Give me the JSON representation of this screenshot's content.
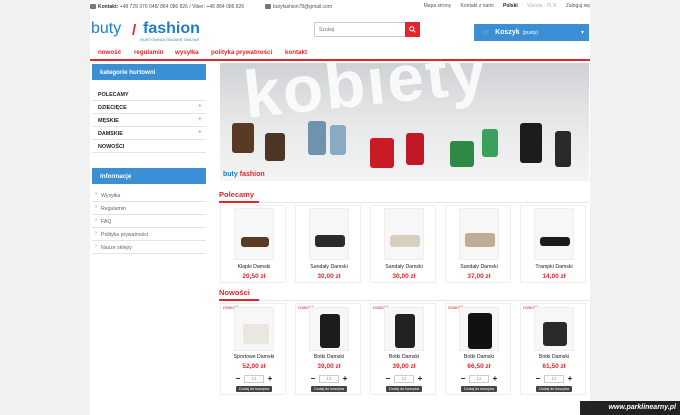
{
  "topbar": {
    "contact_label": "Kontakt:",
    "contact_phones": "+48 729 376 048/ 884 086 826 / Viber: +48 884 086 826",
    "email": "butyfashion78@gmail.com",
    "links": [
      "Mapa strony",
      "Kontakt z nami"
    ],
    "language": "Polski",
    "currency": "Waluta : PLN",
    "login": "Zaloguj się"
  },
  "logo": {
    "word1": "buty",
    "heel": "/",
    "word2": "fashion",
    "tagline": "HURTOWNIA OBUWIE ONLINE"
  },
  "search": {
    "placeholder": "Szukaj"
  },
  "cart": {
    "label": "Koszyk",
    "empty": "(pusty)"
  },
  "nav": [
    "nowość",
    "regulamin",
    "wysyłka",
    "polityka prywatności",
    "kontakt"
  ],
  "sidebar": {
    "categories_title": "kategorie hurtowni",
    "categories": [
      {
        "label": "POLECAMY",
        "expandable": false
      },
      {
        "label": "DZIECIĘCE",
        "expandable": true
      },
      {
        "label": "MĘSKIE",
        "expandable": true
      },
      {
        "label": "DAMSKIE",
        "expandable": true
      },
      {
        "label": "NOWOŚCI",
        "expandable": false
      }
    ],
    "info_title": "informacje",
    "info_items": [
      "Wysyłka",
      "Regulamin",
      "FAQ",
      "Polityka prywatności",
      "Nasze sklepy"
    ]
  },
  "banner": {
    "headline": "kobiety",
    "logo_left": "buty",
    "logo_right": "fashion"
  },
  "sections": {
    "featured_title": "Polecamy",
    "new_title": "Nowości"
  },
  "featured": [
    {
      "name": "Klapki Damski",
      "price": "20,50 zł"
    },
    {
      "name": "Sandały Damski",
      "price": "30,00 zł"
    },
    {
      "name": "Sandały Damski",
      "price": "30,00 zł"
    },
    {
      "name": "Sandały Damski",
      "price": "37,00 zł"
    },
    {
      "name": "Trampki Damski",
      "price": "14,00 zł"
    }
  ],
  "new_products": [
    {
      "badge": "nowość",
      "name": "Sportowe Damski",
      "price": "52,00 zł",
      "qty": "12",
      "add": "Dodaj do koszyka"
    },
    {
      "badge": "nowość",
      "name": "Botki Damski",
      "price": "39,00 zł",
      "qty": "12",
      "add": "Dodaj do koszyka"
    },
    {
      "badge": "nowość",
      "name": "Botki Damski",
      "price": "39,00 zł",
      "qty": "12",
      "add": "Dodaj do koszyka"
    },
    {
      "badge": "nowość",
      "name": "Botki Damski",
      "price": "66,50 zł",
      "qty": "12",
      "add": "Dodaj do koszyka"
    },
    {
      "badge": "nowość",
      "name": "Botki Damski",
      "price": "61,50 zł",
      "qty": "12",
      "add": "Dodaj do koszyka"
    }
  ],
  "watermark": "www.parklinearny.pl",
  "colors": {
    "accent_red": "#e2262b",
    "brand_blue": "#3b8fd5"
  }
}
